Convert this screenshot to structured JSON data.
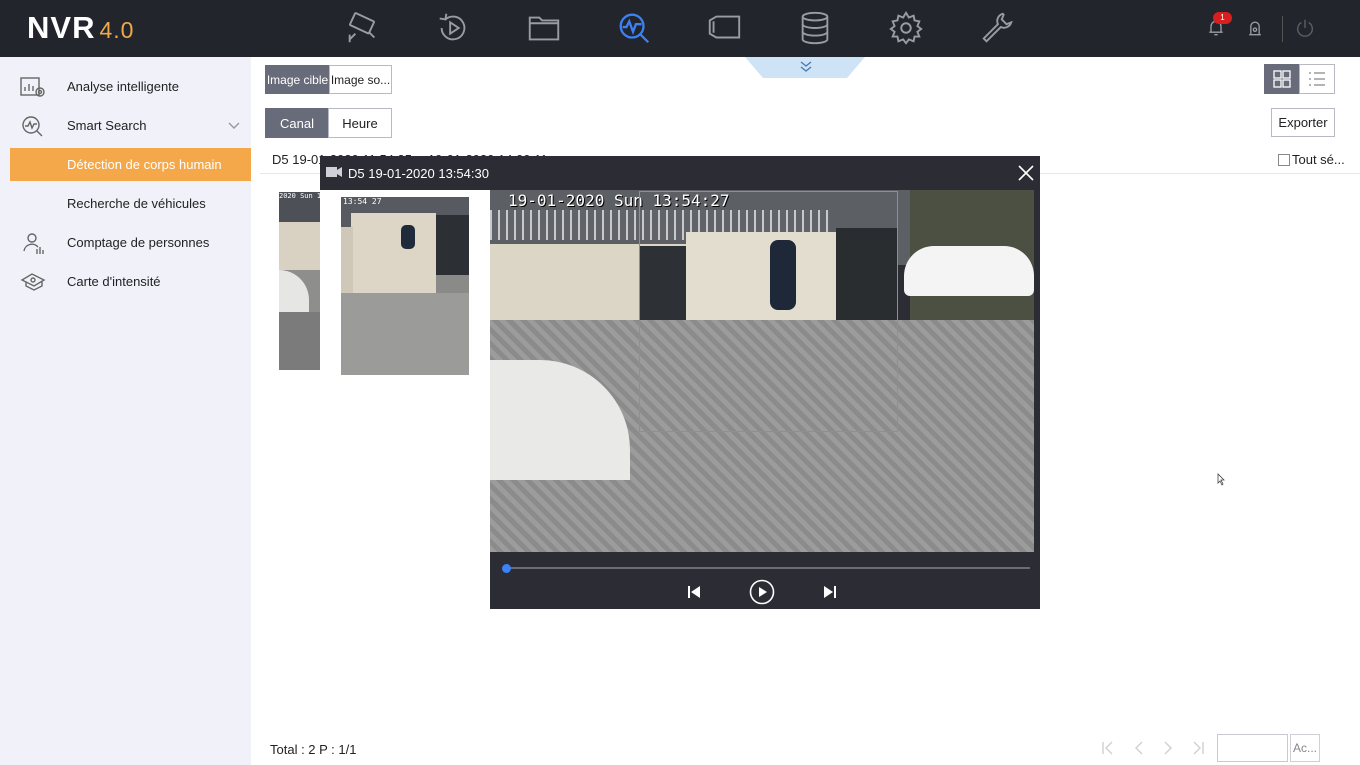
{
  "app": {
    "logo_main": "NVR",
    "logo_version": "4.0"
  },
  "topnav": {
    "items": [
      {
        "name": "live-view",
        "icon": "camera-icon"
      },
      {
        "name": "playback",
        "icon": "playback-icon"
      },
      {
        "name": "file-management",
        "icon": "folder-icon"
      },
      {
        "name": "smart-analysis",
        "icon": "smart-search-icon",
        "active": true
      },
      {
        "name": "tag",
        "icon": "tag-icon"
      },
      {
        "name": "storage",
        "icon": "database-icon"
      },
      {
        "name": "configuration",
        "icon": "gear-icon"
      },
      {
        "name": "maintenance",
        "icon": "wrench-icon"
      }
    ],
    "alarm_count": "1",
    "accent_color": "#3b82f6"
  },
  "sidebar": {
    "items": [
      {
        "label": "Analyse intelligente",
        "icon": "analytics-icon"
      },
      {
        "label": "Smart Search",
        "icon": "smart-search-icon"
      },
      {
        "label": "Détection de corps humain",
        "active": true
      },
      {
        "label": "Recherche de véhicules"
      },
      {
        "label": "Comptage de personnes",
        "icon": "people-count-icon"
      },
      {
        "label": "Carte d'intensité",
        "icon": "heatmap-icon"
      }
    ],
    "active_color": "#f5a84a"
  },
  "main": {
    "image_tabs": [
      "Image cible",
      "Image so..."
    ],
    "sort_tabs": [
      "Canal",
      "Heure"
    ],
    "export_label": "Exporter",
    "result_header": "D5 19-01-2020 11:54:35 -- 19-01-2020 14:00:11",
    "select_all_label": "Tout sé...",
    "thumbs": [
      {
        "osd": "2020 Sun 1"
      },
      {
        "osd": "13:54 27"
      }
    ],
    "footer_total": "Total : 2  P : 1/1",
    "page_input_value": "",
    "go_label": "Ac..."
  },
  "popup": {
    "title": "D5 19-01-2020 13:54:30",
    "video_osd": "19-01-2020 Sun 13:54:27",
    "progress": 0.0,
    "detection_color": "#1edc2a"
  }
}
